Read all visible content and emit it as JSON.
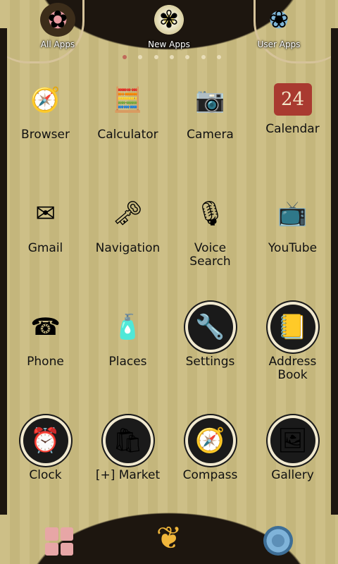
{
  "tabs": [
    {
      "label": "All Apps",
      "icon": "rose-flower-icon"
    },
    {
      "label": "New Apps",
      "icon": "daisy-flower-icon"
    },
    {
      "label": "User Apps",
      "icon": "forget-me-not-icon"
    }
  ],
  "page_indicator": {
    "count": 7,
    "active": 0
  },
  "apps": [
    {
      "label": "Browser",
      "icon": "globe-compass-icon",
      "glyph": "🧭"
    },
    {
      "label": "Calculator",
      "icon": "calculator-blocks-icon",
      "glyph": "🧮"
    },
    {
      "label": "Camera",
      "icon": "vintage-camera-icon",
      "glyph": "📷"
    },
    {
      "label": "Calendar",
      "icon": "calendar-24-icon",
      "glyph": "24"
    },
    {
      "label": "Gmail",
      "icon": "envelope-letter-icon",
      "glyph": "✉"
    },
    {
      "label": "Navigation",
      "icon": "antique-key-icon",
      "glyph": "🗝"
    },
    {
      "label": "Voice\nSearch",
      "icon": "vintage-microphone-icon",
      "glyph": "🎙"
    },
    {
      "label": "YouTube",
      "icon": "retro-tv-icon",
      "glyph": "📺"
    },
    {
      "label": "Phone",
      "icon": "antique-telephone-icon",
      "glyph": "☎"
    },
    {
      "label": "Places",
      "icon": "perfume-bottle-icon",
      "glyph": "🧴"
    },
    {
      "label": "Settings",
      "icon": "wrench-screwdriver-icon",
      "glyph": "🔧"
    },
    {
      "label": "Address\nBook",
      "icon": "contact-book-icon",
      "glyph": "📒"
    },
    {
      "label": "Clock",
      "icon": "alarm-clock-icon",
      "glyph": "⏰"
    },
    {
      "label": "[+] Market",
      "icon": "shopping-bag-icon",
      "glyph": "🛍"
    },
    {
      "label": "Compass",
      "icon": "compass-icon",
      "glyph": "🧭"
    },
    {
      "label": "Gallery",
      "icon": "photo-gallery-icon",
      "glyph": "🖼"
    }
  ],
  "dock": [
    {
      "name": "app-drawer-icon"
    },
    {
      "name": "butterfly-icon"
    },
    {
      "name": "gear-settings-icon"
    }
  ]
}
